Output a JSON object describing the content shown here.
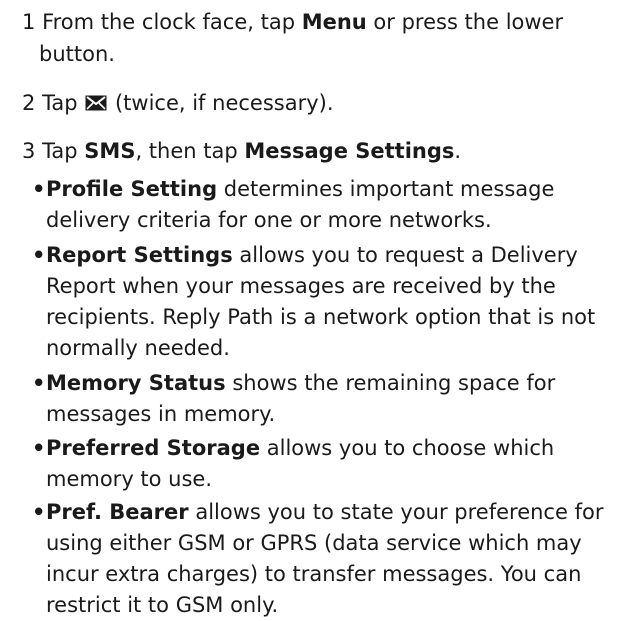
{
  "steps": [
    {
      "num": "1",
      "pre": "From the clock face, tap ",
      "bold": "Menu",
      "post": " or press the lower",
      "line2": "button."
    },
    {
      "num": "2",
      "pre": "Tap ",
      "icon": "envelope-icon",
      "post": " (twice, if necessary)."
    },
    {
      "num": "3",
      "pre": "Tap ",
      "bold1": "SMS",
      "mid": ", then tap ",
      "bold2": "Message Settings",
      "post": "."
    }
  ],
  "bullets": [
    {
      "term": "Profile Setting",
      "text": " determines important message",
      "lines": [
        "delivery criteria for one or more networks."
      ]
    },
    {
      "term": "Report Settings",
      "text": " allows you to request a Delivery",
      "lines": [
        "Report when your messages are received by the",
        "recipients. Reply Path is a network option that is not",
        "normally needed."
      ]
    },
    {
      "term": "Memory Status",
      "text": " shows the remaining space for",
      "lines": [
        "messages in memory."
      ]
    },
    {
      "term": "Preferred Storage",
      "text": " allows you to choose which",
      "lines": [
        "memory to use."
      ]
    },
    {
      "term": "Pref. Bearer",
      "text": " allows you to state your preference for",
      "lines": [
        "using either GSM or GPRS (data service which may",
        "incur extra charges) to transfer messages. You can",
        "restrict it to GSM only."
      ]
    }
  ],
  "bullet_glyph": "•"
}
